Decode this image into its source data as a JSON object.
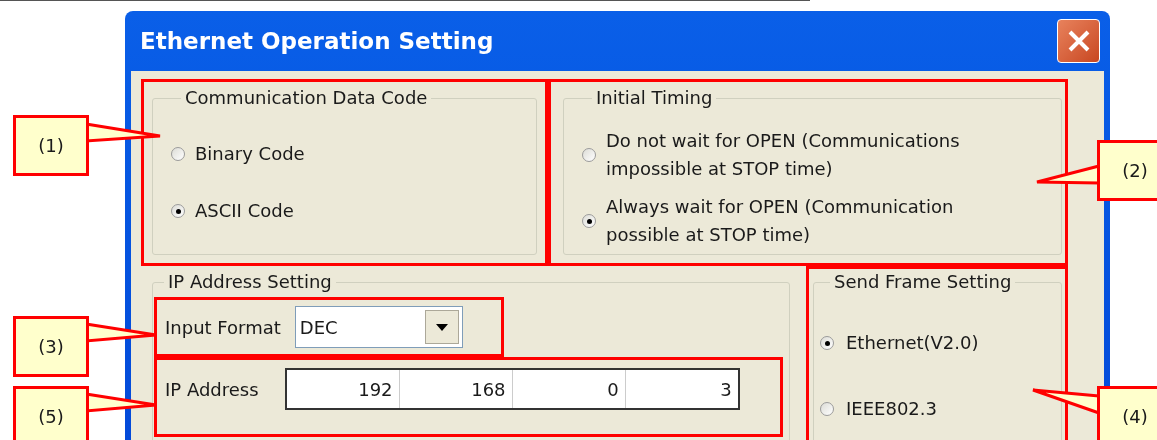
{
  "window": {
    "title": "Ethernet Operation Setting"
  },
  "communication_data_code": {
    "title": "Communication Data Code",
    "options": [
      {
        "lines": [
          "Binary Code"
        ],
        "selected": false
      },
      {
        "lines": [
          "ASCII Code"
        ],
        "selected": true
      }
    ]
  },
  "initial_timing": {
    "title": "Initial Timing",
    "options": [
      {
        "lines": [
          "Do not wait for OPEN (Communications",
          "impossible at STOP time)"
        ],
        "selected": false
      },
      {
        "lines": [
          "Always wait for OPEN (Communication",
          "possible at STOP time)"
        ],
        "selected": true
      }
    ]
  },
  "ip_address_setting": {
    "title": "IP Address Setting",
    "input_format": {
      "label": "Input Format",
      "value": "DEC"
    },
    "ip_address": {
      "label": "IP Address",
      "octets": [
        "192",
        "168",
        "0",
        "3"
      ]
    }
  },
  "send_frame_setting": {
    "title": "Send Frame Setting",
    "options": [
      {
        "lines": [
          "Ethernet(V2.0)"
        ],
        "selected": true
      },
      {
        "lines": [
          "IEEE802.3"
        ],
        "selected": false
      }
    ]
  },
  "callouts": [
    {
      "label": "(1)"
    },
    {
      "label": "(2)"
    },
    {
      "label": "(3)"
    },
    {
      "label": "(5)"
    },
    {
      "label": "(4)"
    }
  ]
}
